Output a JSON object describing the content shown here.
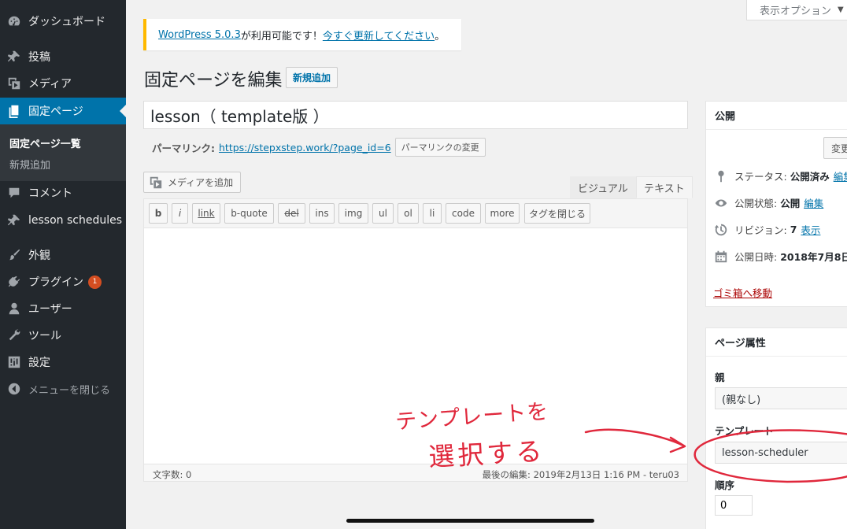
{
  "sidebar": {
    "items": [
      {
        "label": "ダッシュボード",
        "icon": "dashboard-icon"
      },
      {
        "label": "投稿",
        "icon": "pin-icon"
      },
      {
        "label": "メディア",
        "icon": "media-icon"
      },
      {
        "label": "固定ページ",
        "icon": "page-icon"
      },
      {
        "label": "コメント",
        "icon": "comment-icon"
      },
      {
        "label": "lesson schedules",
        "icon": "pin-icon"
      },
      {
        "label": "外観",
        "icon": "brush-icon"
      },
      {
        "label": "プラグイン",
        "icon": "plugin-icon",
        "badge": "1"
      },
      {
        "label": "ユーザー",
        "icon": "user-icon"
      },
      {
        "label": "ツール",
        "icon": "wrench-icon"
      },
      {
        "label": "設定",
        "icon": "settings-icon"
      },
      {
        "label": "メニューを閉じる",
        "icon": "collapse-icon"
      }
    ],
    "submenu": [
      "固定ページ一覧",
      "新規追加"
    ]
  },
  "screen_options": {
    "label": "表示オプション"
  },
  "notice": {
    "link": "WordPress 5.0.3",
    "text": " が利用可能です！",
    "update_link": "今すぐ更新してください",
    "end": "。"
  },
  "header": {
    "title": "固定ページを編集",
    "add_new": "新規追加"
  },
  "post": {
    "title": "lesson（ template版 ）",
    "permalink_label": "パーマリンク:",
    "permalink_url": "https://stepxstep.work/?page_id=6",
    "permalink_change": "パーマリンクの変更"
  },
  "editor": {
    "add_media": "メディアを追加",
    "tab_visual": "ビジュアル",
    "tab_text": "テキスト",
    "quicktags": [
      "b",
      "i",
      "link",
      "b-quote",
      "del",
      "ins",
      "img",
      "ul",
      "ol",
      "li",
      "code",
      "more",
      "タグを閉じる"
    ],
    "word_count": "文字数: 0",
    "last_edit": "最後の編集: 2019年2月13日 1:16 PM - teru03"
  },
  "publish": {
    "title": "公開",
    "preview": "変更",
    "status_label": "ステータス:",
    "status_value": "公開済み",
    "visibility_label": "公開状態:",
    "visibility_value": "公開",
    "revisions_label": "リビジョン:",
    "revisions_value": "7",
    "revisions_link": "表示",
    "date_label": "公開日時:",
    "date_value": "2018年7月8日",
    "edit_link": "編集",
    "trash": "ゴミ箱へ移動"
  },
  "attributes": {
    "title": "ページ属性",
    "parent_label": "親",
    "parent_value": "(親なし)",
    "template_label": "テンプレート",
    "template_value": "lesson-scheduler",
    "order_label": "順序",
    "order_value": "0"
  },
  "annotation": {
    "line1": "テンプレートを",
    "line2": "選択する",
    "color": "#e0283c"
  }
}
